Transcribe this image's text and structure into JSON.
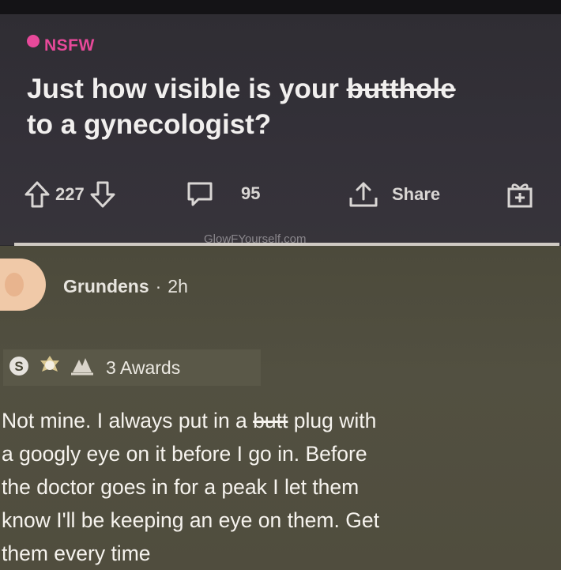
{
  "post": {
    "nsfw_label": "NSFW",
    "title_before": "Just how visible is your ",
    "title_struck": "butthole",
    "title_after": "to a gynecologist?",
    "upvotes": "227",
    "comments": "95",
    "share_label": "Share",
    "watermark": "GlowFYourself.com"
  },
  "comment": {
    "author": "Grundens",
    "separator": "·",
    "time": "2h",
    "awards_label": "3 Awards",
    "lines": [
      "Not mine. I always put in a ",
      "plug with",
      "a googly eye on it before I go in. Before",
      "the doctor goes in for a peak I let them",
      "know I'll be keeping an eye on them. Get",
      "them every time"
    ],
    "struck_word": "butt"
  },
  "colors": {
    "nsfw": "#e7499a",
    "post_bg": "#343139",
    "comment_bg": "#504d3e"
  }
}
